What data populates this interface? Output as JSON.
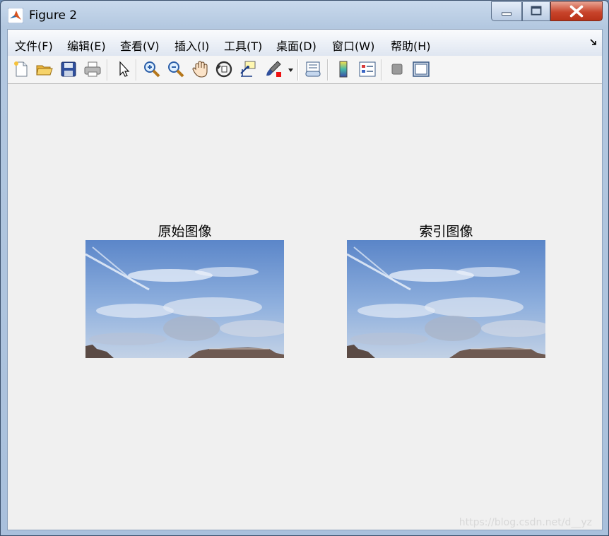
{
  "window": {
    "title": "Figure 2"
  },
  "menu": [
    {
      "label": "文件(F)"
    },
    {
      "label": "编辑(E)"
    },
    {
      "label": "查看(V)"
    },
    {
      "label": "插入(I)"
    },
    {
      "label": "工具(T)"
    },
    {
      "label": "桌面(D)"
    },
    {
      "label": "窗口(W)"
    },
    {
      "label": "帮助(H)"
    }
  ],
  "toolbar_icons": [
    "new-figure-icon",
    "open-file-icon",
    "save-icon",
    "print-icon",
    "edit-plot-arrow-icon",
    "zoom-in-icon",
    "zoom-out-icon",
    "pan-hand-icon",
    "rotate-3d-icon",
    "data-cursor-icon",
    "brush-icon",
    "link-plot-icon",
    "colorbar-icon",
    "legend-icon",
    "hide-plot-tools-icon",
    "show-plot-tools-icon"
  ],
  "figure": {
    "axes": [
      {
        "title": "原始图像"
      },
      {
        "title": "索引图像"
      }
    ]
  },
  "watermark": "https://blog.csdn.net/d__yz",
  "colors": {
    "background": "#f0f0f0",
    "sky_top": "#5b86c9",
    "sky_mid": "#8fb0de",
    "close_button": "#c8442b"
  }
}
